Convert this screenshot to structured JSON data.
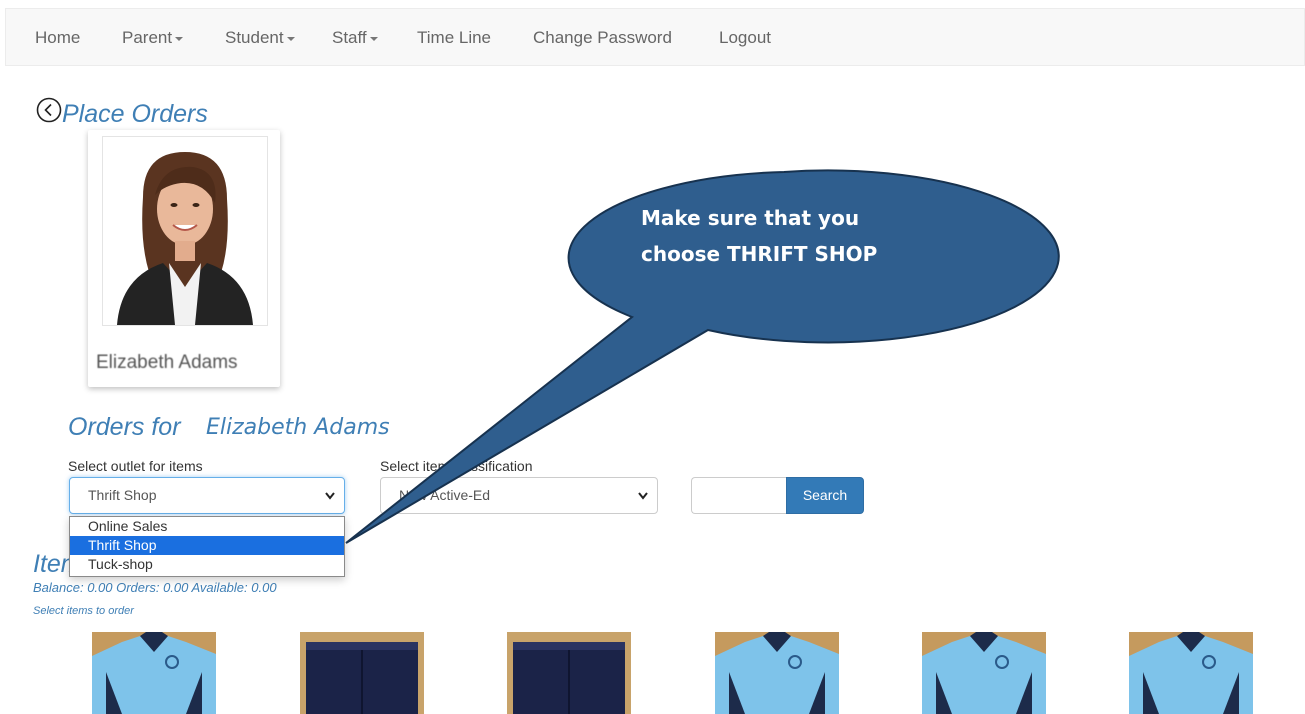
{
  "navbar": {
    "items": [
      {
        "label": "Home",
        "dropdown": false
      },
      {
        "label": "Parent",
        "dropdown": true
      },
      {
        "label": "Student",
        "dropdown": true
      },
      {
        "label": "Staff",
        "dropdown": true
      },
      {
        "label": "Time Line",
        "dropdown": false
      },
      {
        "label": "Change Password",
        "dropdown": false
      },
      {
        "label": "Logout",
        "dropdown": false
      }
    ]
  },
  "header": {
    "title": "Place Orders",
    "back_icon": "circle-chevron-left-icon"
  },
  "profile": {
    "name": "Elizabeth Adams"
  },
  "orders": {
    "heading_prefix": "Orders for",
    "heading_name": "Elizabeth Adams",
    "outlet_label": "Select outlet for items",
    "outlet_selected": "Thrift Shop",
    "outlet_options": [
      "Online Sales",
      "Thrift Shop",
      "Tuck-shop"
    ],
    "classification_label": "Select item classification",
    "classification_selected": "New Active-Ed",
    "search_value": "",
    "search_button": "Search"
  },
  "items": {
    "title": "Items",
    "balance_line": "Balance: 0.00 Orders: 0.00 Available: 0.00",
    "instruction": "Select items to order",
    "products": [
      {
        "kind": "blue-polo-shirt"
      },
      {
        "kind": "navy-shorts"
      },
      {
        "kind": "navy-shorts"
      },
      {
        "kind": "blue-polo-shirt"
      },
      {
        "kind": "blue-polo-shirt"
      },
      {
        "kind": "blue-polo-shirt"
      }
    ]
  },
  "callout": {
    "line1": "Make sure that you",
    "line2": "choose THRIFT SHOP"
  },
  "colors": {
    "accent_blue": "#3f7fb5",
    "button_blue": "#337ab7",
    "callout_fill": "#2f5e8e",
    "selected_option": "#1a6fe0"
  }
}
